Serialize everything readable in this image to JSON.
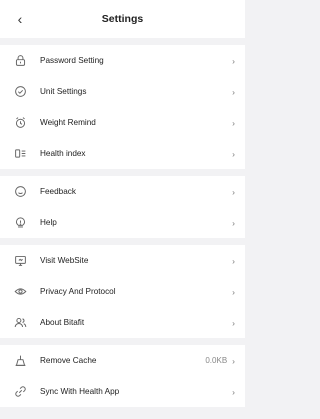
{
  "header": {
    "back_glyph": "‹",
    "title": "Settings"
  },
  "groups": [
    {
      "items": [
        {
          "label": "Password Setting",
          "icon": "lock-icon"
        },
        {
          "label": "Unit Settings",
          "icon": "check-circle-icon"
        },
        {
          "label": "Weight Remind",
          "icon": "alarm-clock-icon"
        },
        {
          "label": "Health index",
          "icon": "list-index-icon"
        }
      ]
    },
    {
      "items": [
        {
          "label": "Feedback",
          "icon": "smile-icon"
        },
        {
          "label": "Help",
          "icon": "help-bulb-icon"
        }
      ]
    },
    {
      "items": [
        {
          "label": "Visit WebSite",
          "icon": "monitor-icon"
        },
        {
          "label": "Privacy And Protocol",
          "icon": "eye-icon"
        },
        {
          "label": "About Bitafit",
          "icon": "users-icon"
        }
      ]
    },
    {
      "items": [
        {
          "label": "Remove Cache",
          "icon": "broom-icon",
          "value": "0.0KB"
        },
        {
          "label": "Sync With Health App",
          "icon": "sync-link-icon"
        }
      ]
    }
  ],
  "chevron": "›"
}
